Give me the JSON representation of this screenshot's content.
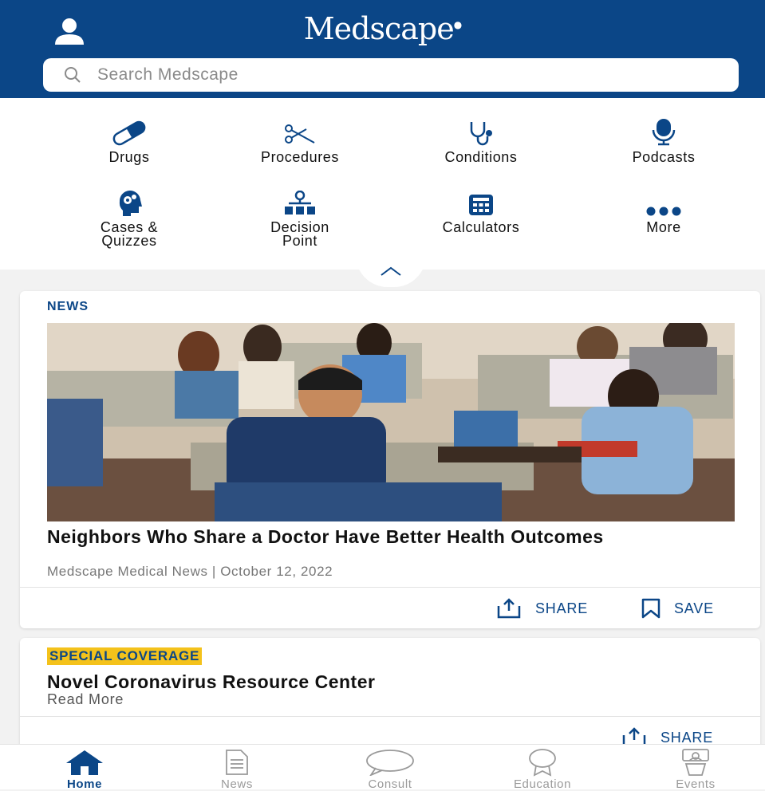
{
  "colors": {
    "brand": "#0b4687",
    "highlight": "#f4c21b",
    "inactive": "#9a9a9a"
  },
  "header": {
    "logo_main": "Medscape",
    "search_placeholder": "Search Medscape",
    "profile_icon": "person-icon"
  },
  "quick_links": [
    {
      "label": "Drugs",
      "icon": "pill-icon"
    },
    {
      "label": "Procedures",
      "icon": "scissors-icon"
    },
    {
      "label": "Conditions",
      "icon": "stethoscope-icon"
    },
    {
      "label": "Podcasts",
      "icon": "microphone-icon"
    },
    {
      "label_line1": "Cases &",
      "label_line2": "Quizzes",
      "icon": "head-gears-icon"
    },
    {
      "label_line1": "Decision",
      "label_line2": "Point",
      "icon": "org-chart-icon"
    },
    {
      "label": "Calculators",
      "icon": "calculator-icon"
    },
    {
      "label": "More",
      "icon": "more-dots-icon"
    }
  ],
  "news_card": {
    "kicker": "NEWS",
    "headline": "Neighbors Who Share a Doctor Have Better Health Outcomes",
    "meta": "Medscape Medical News | October 12, 2022",
    "share_label": "SHARE",
    "save_label": "SAVE"
  },
  "covid_card": {
    "kicker": "SPECIAL COVERAGE",
    "title": "Novel Coronavirus Resource Center",
    "read_more": "Read More",
    "share_label": "SHARE"
  },
  "tabbar": [
    {
      "label": "Home",
      "icon": "home-icon",
      "active": true
    },
    {
      "label": "News",
      "icon": "document-icon",
      "active": false
    },
    {
      "label": "Consult",
      "icon": "chat-bubble-icon",
      "active": false
    },
    {
      "label": "Education",
      "icon": "award-ribbon-icon",
      "active": false
    },
    {
      "label": "Events",
      "icon": "presenter-icon",
      "active": false
    }
  ]
}
